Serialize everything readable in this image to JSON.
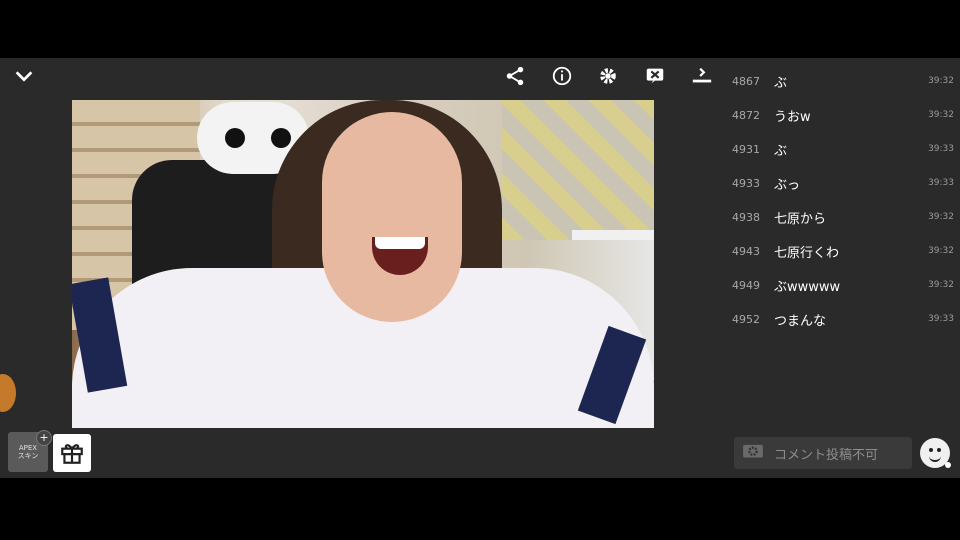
{
  "toolbar": {
    "collapse_icon": "chevron-down-icon",
    "share_icon": "share-icon",
    "info_icon": "info-icon",
    "settings_icon": "gear-icon",
    "comment_off_icon": "comment-hide-icon",
    "quality_icon": "stream-quality-icon"
  },
  "comments": [
    {
      "num": "4867",
      "text": "ぶ",
      "time": "39:32"
    },
    {
      "num": "4872",
      "text": "うおw",
      "time": "39:32"
    },
    {
      "num": "4931",
      "text": "ぶ",
      "time": "39:33"
    },
    {
      "num": "4933",
      "text": "ぶっ",
      "time": "39:33"
    },
    {
      "num": "4938",
      "text": "七原から",
      "time": "39:32"
    },
    {
      "num": "4943",
      "text": "七原行くわ",
      "time": "39:32"
    },
    {
      "num": "4949",
      "text": "ぶwwwww",
      "time": "39:32"
    },
    {
      "num": "4952",
      "text": "つまんな",
      "time": "39:33"
    }
  ],
  "comment_input": {
    "placeholder": "コメント投稿不可"
  },
  "ad_banner": {
    "line1": "APEX",
    "line2": "スキン"
  },
  "colors": {
    "background": "#2a2a2a",
    "letterbox": "#000000",
    "comment_text": "#ffffff",
    "comment_meta": "#a8a8a8"
  }
}
